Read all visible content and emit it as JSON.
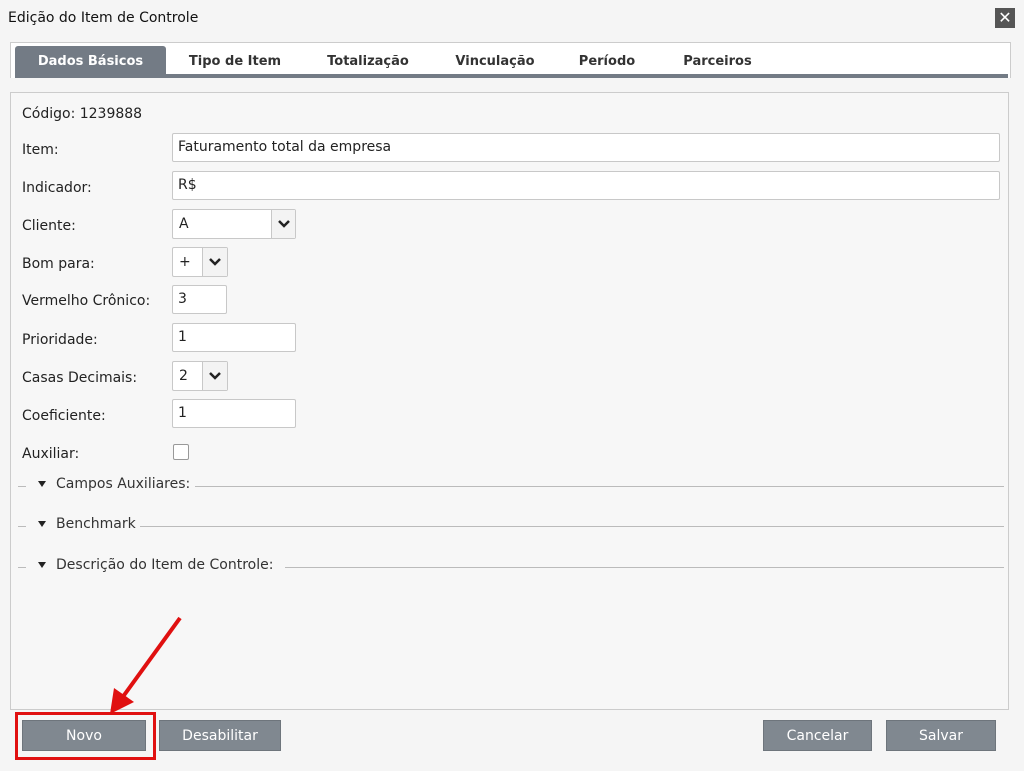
{
  "window": {
    "title": "Edição do Item de Controle",
    "close_symbol": "✕"
  },
  "tabs": [
    {
      "label": "Dados Básicos",
      "active": true
    },
    {
      "label": "Tipo de Item"
    },
    {
      "label": "Totalização"
    },
    {
      "label": "Vinculação"
    },
    {
      "label": "Período"
    },
    {
      "label": "Parceiros"
    }
  ],
  "form": {
    "codigo_label": "Código: 1239888",
    "item": {
      "label": "Item:",
      "value": "Faturamento total da empresa"
    },
    "indicador": {
      "label": "Indicador:",
      "value": "R$"
    },
    "cliente": {
      "label": "Cliente:",
      "value": "A"
    },
    "bom_para": {
      "label": "Bom para:",
      "value": "+"
    },
    "vermelho_cronico": {
      "label": "Vermelho Crônico:",
      "value": "3"
    },
    "prioridade": {
      "label": "Prioridade:",
      "value": "1"
    },
    "casas_decimais": {
      "label": "Casas Decimais:",
      "value": "2"
    },
    "coeficiente": {
      "label": "Coeficiente:",
      "value": "1"
    },
    "auxiliar": {
      "label": "Auxiliar:",
      "checked": false
    }
  },
  "sections": [
    {
      "label": "Campos Auxiliares:"
    },
    {
      "label": "Benchmark"
    },
    {
      "label": "Descrição do Item de Controle:"
    }
  ],
  "buttons": {
    "novo": "Novo",
    "desabilitar": "Desabilitar",
    "cancelar": "Cancelar",
    "salvar": "Salvar"
  },
  "colors": {
    "tab_active": "#737b85",
    "button": "#808890",
    "annotation": "#e01010"
  }
}
